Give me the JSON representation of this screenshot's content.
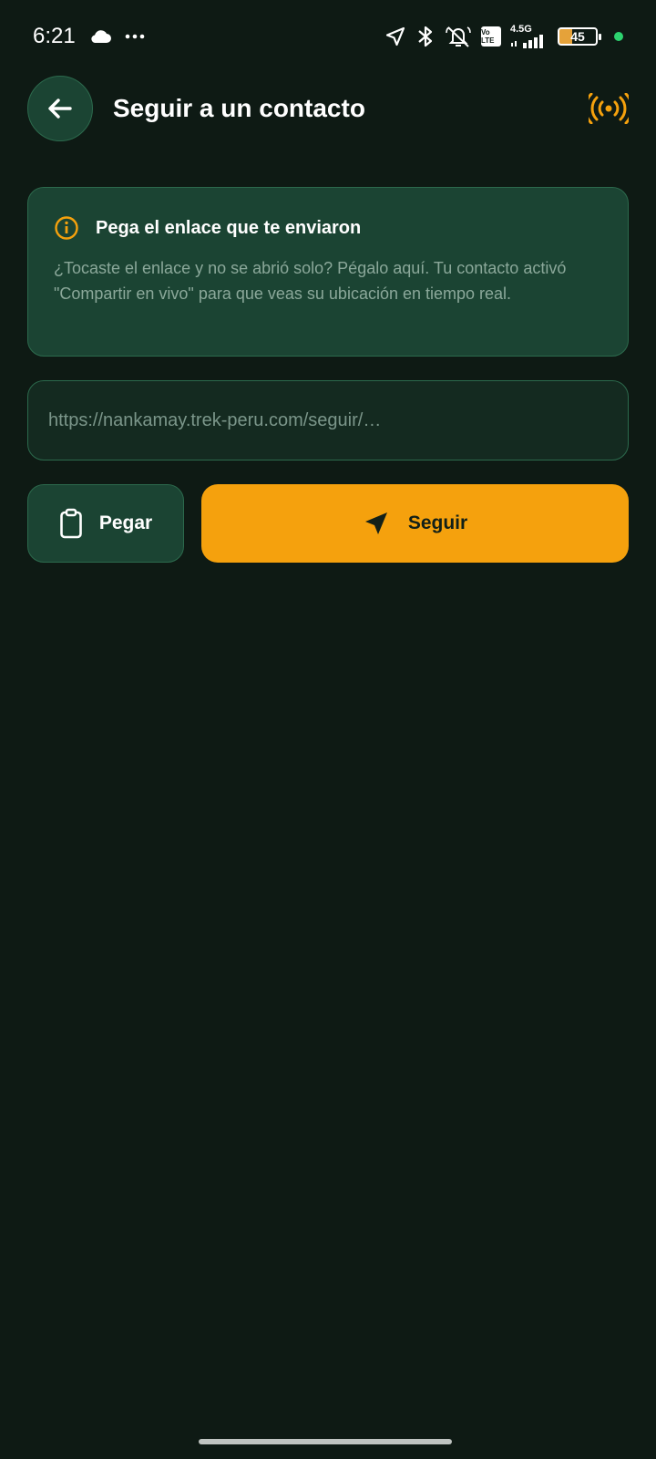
{
  "status_bar": {
    "time": "6:21",
    "network_label": "4.5G",
    "volte_label": "Vo LTE",
    "battery_level": "45",
    "icons": [
      "cloud-icon",
      "more-dots-icon",
      "location-arrow-icon",
      "bluetooth-icon",
      "alarm-off-icon",
      "volte-icon",
      "signal-icon",
      "battery-icon"
    ]
  },
  "header": {
    "title": "Seguir a un contacto",
    "back_icon": "arrow-left-icon",
    "live_icon": "broadcast-icon"
  },
  "info_card": {
    "icon": "info-icon",
    "title": "Pega el enlace que te enviaron",
    "body": "¿Tocaste el enlace y no se abrió solo? Pégalo aquí. Tu contacto activó \"Compartir en vivo\" para que veas su ubicación en tiempo real."
  },
  "url_input": {
    "value": "",
    "placeholder": "https://nankamay.trek-peru.com/seguir/…"
  },
  "actions": {
    "paste_label": "Pegar",
    "paste_icon": "clipboard-icon",
    "follow_label": "Seguir",
    "follow_icon": "navigation-arrow-icon"
  },
  "colors": {
    "background": "#0e1a14",
    "card": "#1b4433",
    "border": "#2c6a4d",
    "accent": "#f5a10d",
    "muted_text": "#8ba89a"
  }
}
